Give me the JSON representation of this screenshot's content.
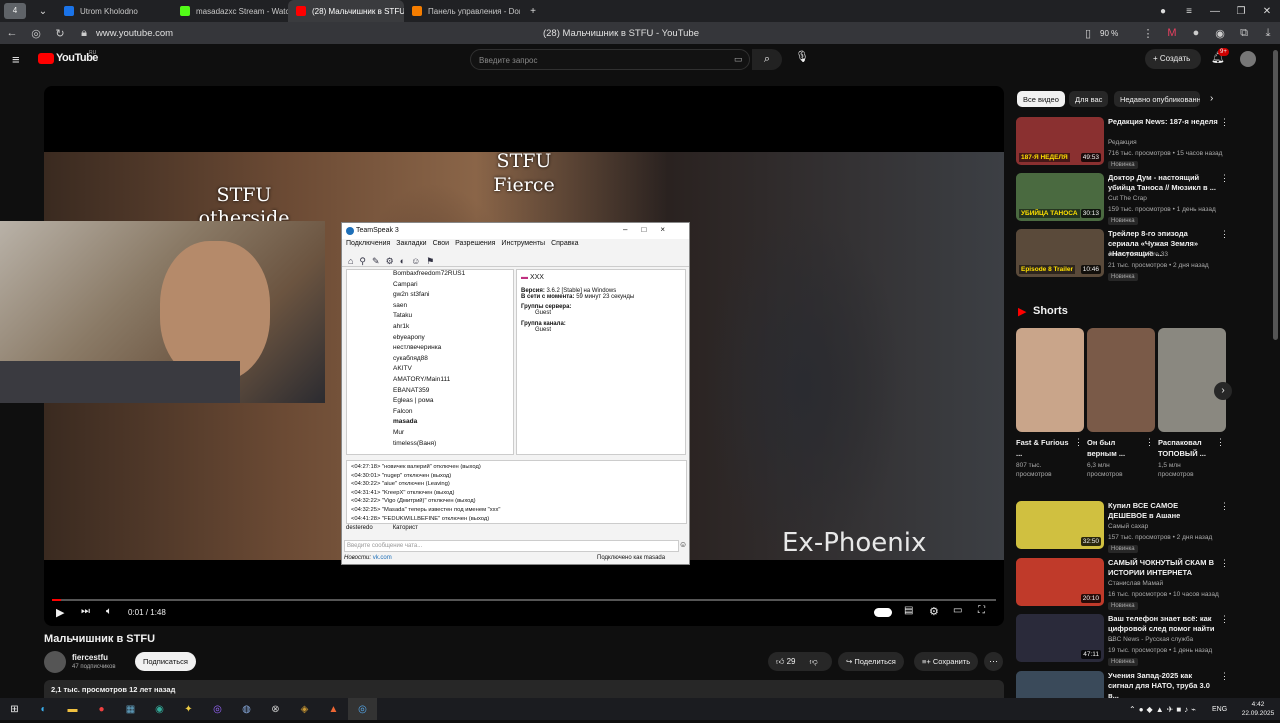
{
  "tabs": [
    {
      "label": "Utrom Kholodno",
      "color": "#1a73e8"
    },
    {
      "label": "masadazxc Stream - Watc",
      "color": "#53fc18"
    },
    {
      "label": "(28) Мальчишник в STFU",
      "color": "#ff0000"
    },
    {
      "label": "Панель управления - Don",
      "color": "#f57d00"
    }
  ],
  "browser": {
    "url": "www.youtube.com",
    "page_title": "(28) Мальчишник в STFU - YouTube",
    "zoom": "90 %",
    "tab_count": "4"
  },
  "yt": {
    "logo": "YouTube",
    "region": "RU",
    "search_placeholder": "Введите запрос",
    "create_label": "Создать",
    "notif_count": "9+"
  },
  "video": {
    "overlay_1": "STFU",
    "overlay_2": "Fierce",
    "overlay_3": "STFU",
    "overlay_4": "otherside",
    "watermark": "Ex-Phoenix",
    "time": "0:01 / 1:48",
    "progress_fraction": 0.01,
    "title": "Мальчишник в STFU",
    "channel": "fiercestfu",
    "subs": "47 подписчиков",
    "subscribe": "Подписаться",
    "likes": "29",
    "share": "Поделиться",
    "save": "Сохранить",
    "meta": "2,1 тыс. просмотров  12 лет назад"
  },
  "teamspeak": {
    "title": "TeamSpeak 3",
    "menu": [
      "Подключения",
      "Закладки",
      "Свои",
      "Разрешения",
      "Инструменты",
      "Справка"
    ],
    "users": [
      "Bombaxfreedom72RUS1",
      "Campari",
      "gw2n st3fani",
      "saen",
      "Tataku",
      "ahr1k",
      "ebyeapony",
      "нестлвечеринка",
      "сукабляд88",
      "AKITV",
      "AMATORY/Main111",
      "EBANAT359",
      "Egleas | рома",
      "Falcon",
      "masada",
      "Mur",
      "timeless(Ваня)"
    ],
    "info_name": "XXX",
    "info_version_label": "Версия:",
    "info_version": "3.6.2 [Stable] на Windows",
    "info_online_label": "В сети с момента:",
    "info_online": "59 минут 23 секунды",
    "info_sg_label": "Группы сервера:",
    "info_sg": "Guest",
    "info_cg_label": "Группа канала:",
    "info_cg": "Guest",
    "log": [
      "<04:27:18> \"новичек валерий\" отключен (выход)",
      "<04:30:01> \"nugep\" отключен (выход)",
      "<04:30:22> \"aiue\" отключен (Leaving)",
      "<04:31:41> \"KreepX\" отключен (выход)",
      "<04:32:22> \"Vigo (Дмитрий)\" отключен (выход)",
      "<04:32:25> \"Masada\" теперь известен под именем \"xxx\"",
      "<04:41:28> \"FEDUKWILLBEFINE\" отключен (выход)"
    ],
    "tab1": "desteredo",
    "tab2": "Каторист",
    "chat_placeholder": "Введите сообщение чата...",
    "news_label": "Новости:",
    "news_link": "vk.com",
    "status": "Подключено как masada"
  },
  "chips": [
    "Все видео",
    "Для вас",
    "Недавно опубликованные"
  ],
  "related": [
    {
      "title": "Редакция News: 187-я неделя",
      "channel": "Редакция",
      "stats": "716 тыс. просмотров • 15 часов назад",
      "duration": "49:53",
      "badge": "Новинка",
      "thumb_text": "187-Я НЕДЕЛЯ"
    },
    {
      "title": "Доктор Дум - настоящий убийца Таноса // Мюзикл в ...",
      "channel": "Cut The Crap",
      "stats": "159 тыс. просмотров • 1 день назад",
      "duration": "30:13",
      "badge": "Новинка",
      "thumb_text": "УБИЙЦА ТАНОСА"
    },
    {
      "title": "Трейлер 8-го эпизода сериала «Чужая Земля» «Настоящие ...",
      "channel": "Jeremy Ice & Fire 33",
      "stats": "21 тыс. просмотров • 2 дня назад",
      "duration": "10:46",
      "badge": "Новинка",
      "thumb_text": "Episode 8 Trailer"
    }
  ],
  "shorts_title": "Shorts",
  "shorts": [
    {
      "title": "Fast & Furious ...",
      "views": "807 тыс. просмотров",
      "color": "#c9a58a"
    },
    {
      "title": "Он был верным ...",
      "views": "6,3 млн просмотров",
      "color": "#7a5a48"
    },
    {
      "title": "Распаковал ТОПОВЫЙ ...",
      "views": "1,5 млн просмотров",
      "color": "#8a8880"
    }
  ],
  "related2": [
    {
      "title": "Купил ВСЕ САМОЕ ДЕШЕВОЕ в Ашане",
      "channel": "Самый сахар",
      "stats": "157 тыс. просмотров • 2 дня назад",
      "duration": "32:50",
      "badge": "Новинка"
    },
    {
      "title": "САМЫЙ ЧОКНУТЫЙ СКАМ В ИСТОРИИ ИНТЕРНЕТА",
      "channel": "Станислав Мамай",
      "stats": "16 тыс. просмотров • 10 часов назад",
      "duration": "20:10",
      "badge": "Новинка"
    },
    {
      "title": "Ваш телефон знает всё: как цифровой след помог найти ...",
      "channel": "BBC News - Русская служба",
      "stats": "19 тыс. просмотров • 1 день назад",
      "duration": "47:11",
      "badge": "Новинка"
    },
    {
      "title": "Учения Запад-2025 как сигнал для НАТО, труба 3.0 в...",
      "channel": "",
      "stats": "",
      "duration": "",
      "badge": ""
    }
  ],
  "taskbar": {
    "lang": "ENG",
    "time": "4:42",
    "date": "22.09.2025"
  }
}
